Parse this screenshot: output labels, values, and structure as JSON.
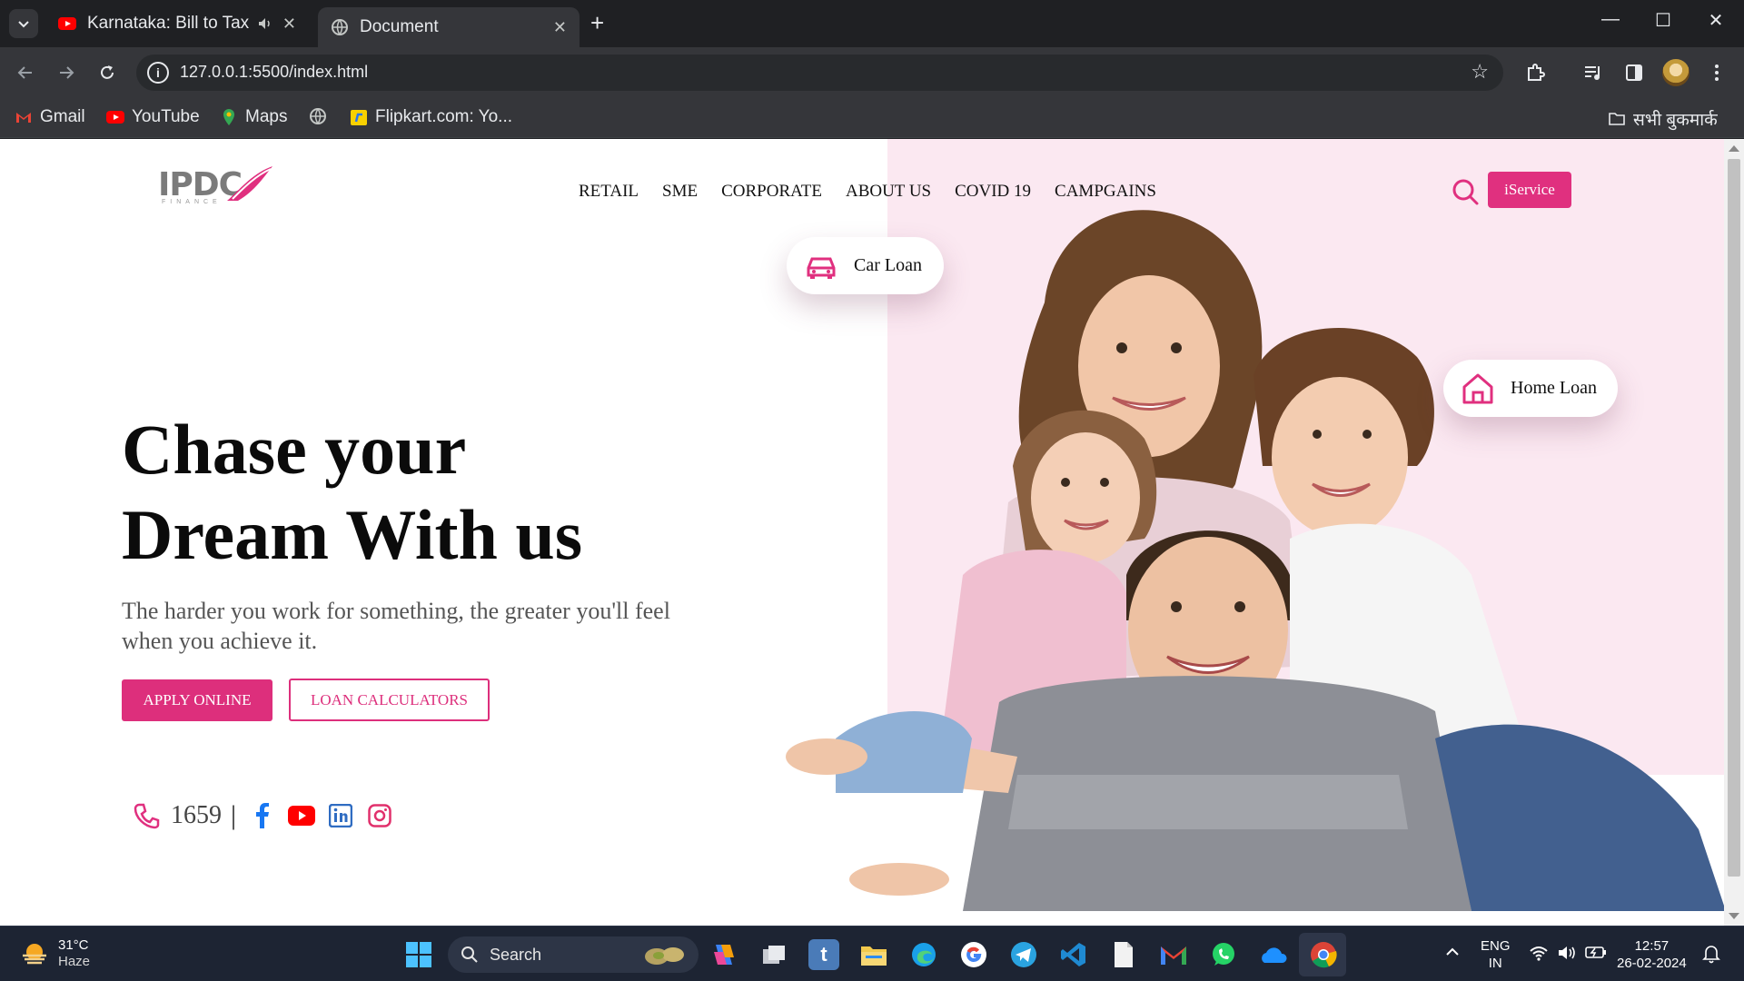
{
  "browser": {
    "tabs": [
      {
        "title": "Karnataka: Bill to Tax T",
        "active": false
      },
      {
        "title": "Document",
        "active": true
      }
    ],
    "address": "127.0.0.1:5500/index.html",
    "bookmarks": [
      "Gmail",
      "YouTube",
      "Maps",
      "Flipkart.com: Yo..."
    ],
    "all_bookmarks": "सभी बुकमार्क"
  },
  "site": {
    "logo": "IPDC",
    "logo_sub": "FINANCE",
    "nav": [
      "RETAIL",
      "SME",
      "CORPORATE",
      "ABOUT US",
      "COVID 19",
      "CAMPGAINS"
    ],
    "iservice": "iService",
    "hero_title_line1": "Chase your",
    "hero_title_line2": "Dream With us",
    "hero_subtitle": "The harder you work for something, the greater you'll feel when you achieve it.",
    "apply_label": "APPLY ONLINE",
    "calc_label": "LOAN CALCULATORS",
    "hotline": "1659",
    "separator": "|",
    "car_loan": "Car Loan",
    "home_loan": "Home Loan",
    "social_icons": [
      "facebook-icon",
      "youtube-icon",
      "linkedin-icon",
      "instagram-icon"
    ],
    "accent_color": "#dd2f7c",
    "panel_color": "#fbe8f1"
  },
  "taskbar": {
    "temperature": "31°C",
    "condition": "Haze",
    "search_placeholder": "Search",
    "lang_line1": "ENG",
    "lang_line2": "IN",
    "time": "12:57",
    "date": "26-02-2024"
  }
}
